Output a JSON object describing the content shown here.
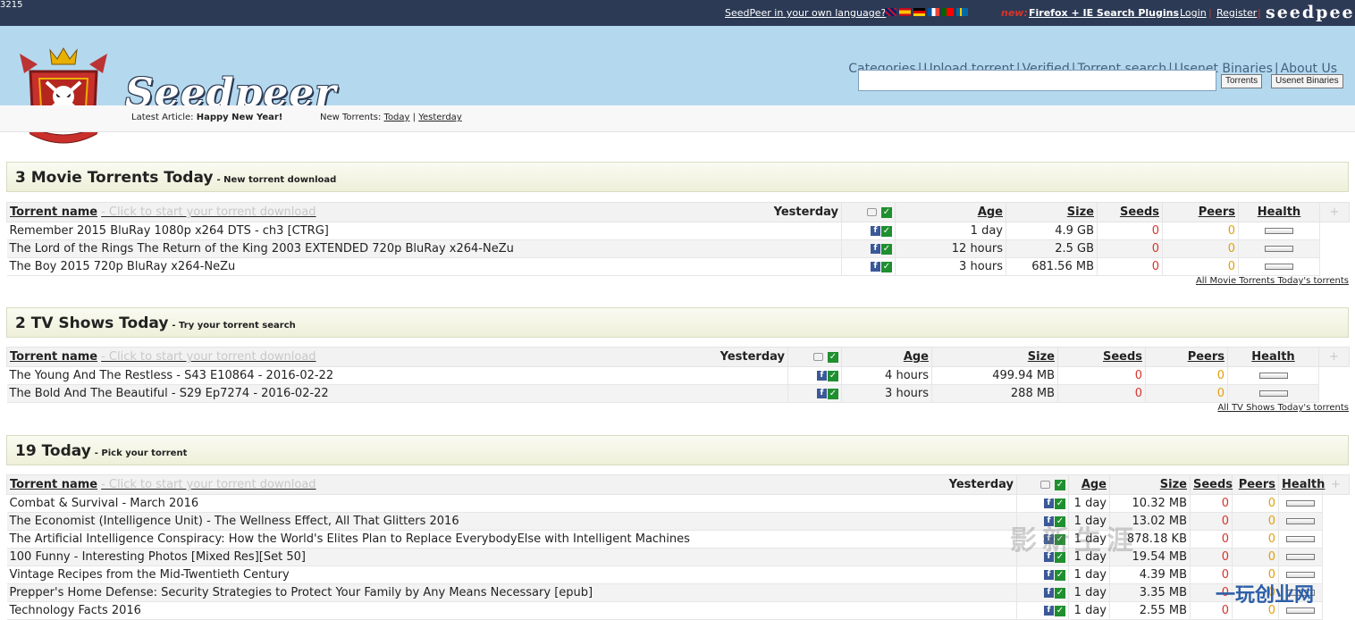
{
  "topbar": {
    "corner_text": "3215",
    "lang_link": "SeedPeer in your own language?",
    "new_label": "new:",
    "plugins_link": "Firefox + IE Search Plugins",
    "login": "Login",
    "register": "Register",
    "brand": "seedpeer"
  },
  "header": {
    "wordmark": "Seedpeer",
    "nav": [
      "Categories",
      "Upload torrent",
      "Verified",
      "Torrent search",
      "Usenet Binaries",
      "About Us"
    ],
    "search_btn_torrents": "Torrents",
    "search_btn_usenet": "Usenet Binaries"
  },
  "subbar": {
    "latest_label": "Latest Article:",
    "latest_title": "Happy New Year!",
    "new_label": "New Torrents:",
    "today": "Today",
    "yesterday": "Yesterday"
  },
  "columns": {
    "name": "Torrent name",
    "hint": "- Click to start your torrent download",
    "yesterday": "Yesterday",
    "age": "Age",
    "size": "Size",
    "seeds": "Seeds",
    "peers": "Peers",
    "health": "Health",
    "plus": "+"
  },
  "sections": [
    {
      "title": "3 Movie Torrents Today",
      "subtitle": "- New torrent download",
      "more_link": "All Movie Torrents Today's torrents",
      "rows": [
        {
          "name": "Remember 2015 BluRay 1080p x264 DTS - ch3 [CTRG]",
          "age": "1 day",
          "size": "4.9 GB",
          "seeds": "0",
          "peers": "0"
        },
        {
          "name": "The Lord of the Rings The Return of the King 2003 EXTENDED 720p BluRay x264-NeZu",
          "age": "12 hours",
          "size": "2.5 GB",
          "seeds": "0",
          "peers": "0"
        },
        {
          "name": "The Boy 2015 720p BluRay x264-NeZu",
          "age": "3 hours",
          "size": "681.56 MB",
          "seeds": "0",
          "peers": "0"
        }
      ]
    },
    {
      "title": "2 TV Shows Today",
      "subtitle": "- Try your torrent search",
      "more_link": "All TV Shows Today's torrents",
      "rows": [
        {
          "name": "The Young And The Restless - S43 E10864 - 2016-02-22",
          "age": "4 hours",
          "size": "499.94 MB",
          "seeds": "0",
          "peers": "0"
        },
        {
          "name": "The Bold And The Beautiful - S29 Ep7274 - 2016-02-22",
          "age": "3 hours",
          "size": "288 MB",
          "seeds": "0",
          "peers": "0"
        }
      ]
    },
    {
      "title": "19 Today",
      "subtitle": "- Pick your torrent",
      "rows": [
        {
          "name": "Combat & Survival - March 2016",
          "age": "1 day",
          "size": "10.32 MB",
          "seeds": "0",
          "peers": "0"
        },
        {
          "name": "The Economist (Intelligence Unit) - The Wellness Effect, All That Glitters 2016",
          "age": "1 day",
          "size": "13.02 MB",
          "seeds": "0",
          "peers": "0"
        },
        {
          "name": "The Artificial Intelligence Conspiracy: How the World's Elites Plan to Replace EverybodyElse with Intelligent Machines",
          "age": "1 day",
          "size": "878.18 KB",
          "seeds": "0",
          "peers": "0"
        },
        {
          "name": "100 Funny - Interesting Photos [Mixed Res][Set 50]",
          "age": "1 day",
          "size": "19.54 MB",
          "seeds": "0",
          "peers": "0"
        },
        {
          "name": "Vintage Recipes from the Mid-Twentieth Century",
          "age": "1 day",
          "size": "4.39 MB",
          "seeds": "0",
          "peers": "0"
        },
        {
          "name": "Prepper's Home Defense: Security Strategies to Protect Your Family by Any Means Necessary [epub]",
          "age": "1 day",
          "size": "3.35 MB",
          "seeds": "0",
          "peers": "0"
        },
        {
          "name": "Technology Facts 2016",
          "age": "1 day",
          "size": "2.55 MB",
          "seeds": "0",
          "peers": "0"
        }
      ]
    }
  ],
  "colors": {
    "topbar": "#2c3a55",
    "header": "#b4d9ef",
    "seeds": "#d9342b",
    "peers": "#e0a010"
  },
  "watermark": "影新生涯",
  "watermark2": "一玩创业网"
}
